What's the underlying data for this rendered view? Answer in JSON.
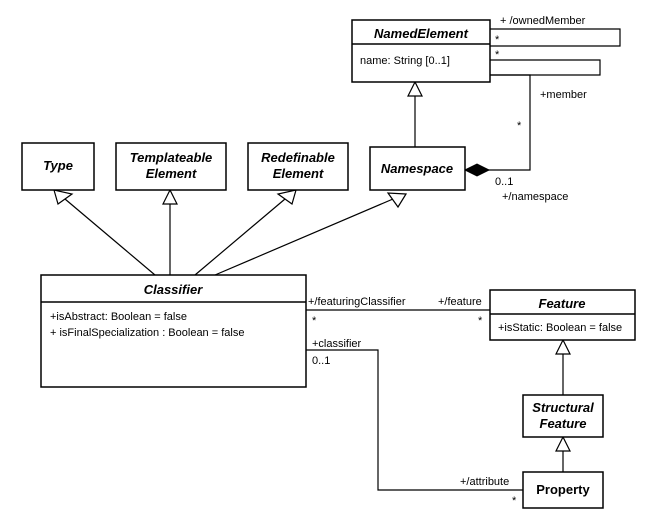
{
  "classes": {
    "namedElement": {
      "name": "NamedElement",
      "attr1": "name: String [0..1]"
    },
    "type": {
      "name": "Type"
    },
    "templateable": {
      "name1": "Templateable",
      "name2": "Element"
    },
    "redefinable": {
      "name1": "Redefinable",
      "name2": "Element"
    },
    "namespace": {
      "name": "Namespace"
    },
    "classifier": {
      "name": "Classifier",
      "attr1": "+isAbstract: Boolean = false",
      "attr2": "+ isFinalSpecialization : Boolean = false"
    },
    "feature": {
      "name": "Feature",
      "attr1": "+isStatic: Boolean = false"
    },
    "structural": {
      "name1": "Structural",
      "name2": "Feature"
    },
    "property": {
      "name": "Property"
    }
  },
  "labels": {
    "ownedMember": "+ /ownedMember",
    "member": "+member",
    "namespaceRole": "+/namespace",
    "featuringClassifier": "+/featuringClassifier",
    "featureRole": "+/feature",
    "classifierRole": "+classifier",
    "attributeRole": "+/attribute",
    "star": "*",
    "zeroOne": "0..1"
  }
}
